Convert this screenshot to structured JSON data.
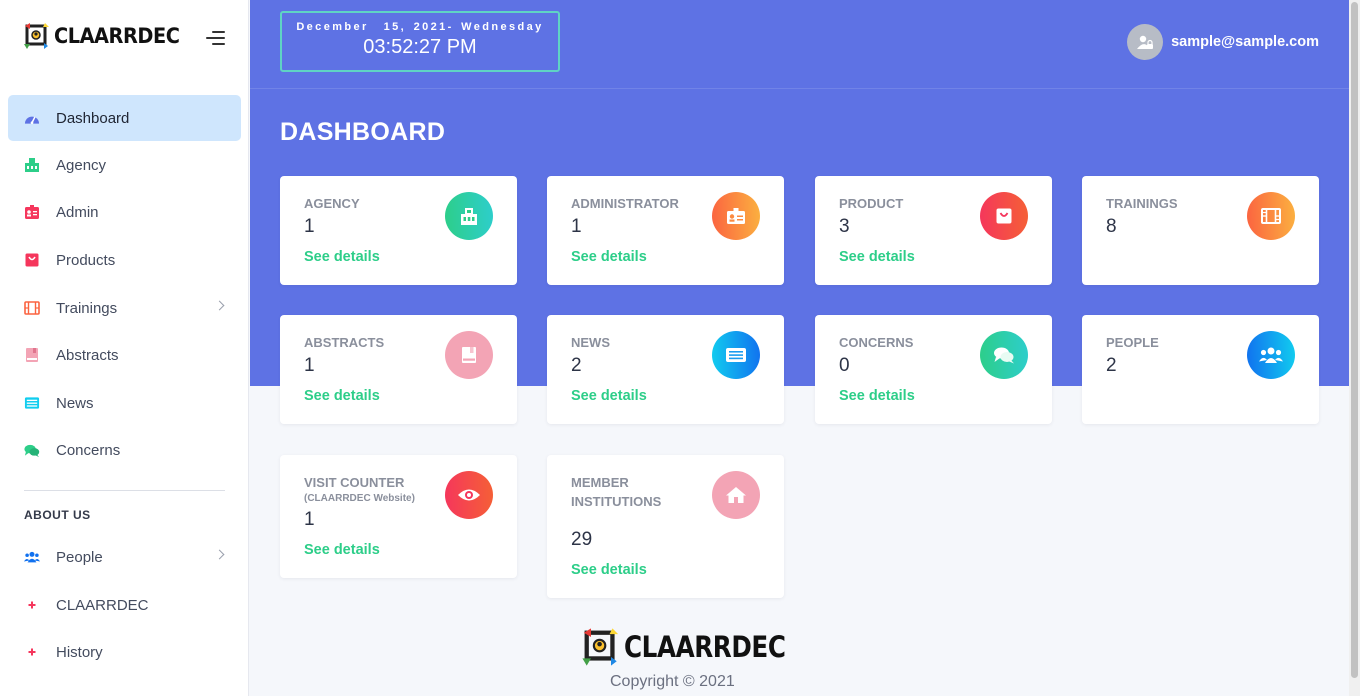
{
  "brand": {
    "name": "CLAARRDEC"
  },
  "header": {
    "date": "December  15, 2021- Wednesday",
    "time": "03:52:27 PM",
    "user_email": "sample@sample.com"
  },
  "sidebar": {
    "items": [
      {
        "label": "Dashboard",
        "icon": "dashboard-icon",
        "active": true
      },
      {
        "label": "Agency",
        "icon": "building-icon"
      },
      {
        "label": "Admin",
        "icon": "id-card-icon"
      },
      {
        "label": "Products",
        "icon": "shopping-bag-icon"
      },
      {
        "label": "Trainings",
        "icon": "film-icon",
        "has_submenu": true
      },
      {
        "label": "Abstracts",
        "icon": "book-icon"
      },
      {
        "label": "News",
        "icon": "newspaper-icon"
      },
      {
        "label": "Concerns",
        "icon": "comments-icon"
      }
    ],
    "section_label": "ABOUT US",
    "about_items": [
      {
        "label": "People",
        "icon": "users-icon",
        "has_submenu": true
      },
      {
        "label": "CLAARRDEC",
        "icon": "plus-icon"
      },
      {
        "label": "History",
        "icon": "plus-icon"
      }
    ]
  },
  "page": {
    "title": "DASHBOARD"
  },
  "cards": [
    {
      "title": "AGENCY",
      "value": "1",
      "link": "See details",
      "icon": "building-icon",
      "color": "#2dce89"
    },
    {
      "title": "ADMINISTRATOR",
      "value": "1",
      "link": "See details",
      "icon": "id-card-icon",
      "color": "#fb6340"
    },
    {
      "title": "PRODUCT",
      "value": "3",
      "link": "See details",
      "icon": "shopping-bag-icon",
      "color": "#f5365c"
    },
    {
      "title": "TRAININGS",
      "value": "8",
      "icon": "film-icon",
      "color": "#fb6340"
    },
    {
      "title": "ABSTRACTS",
      "value": "1",
      "link": "See details",
      "icon": "book-icon",
      "color": "#f3a4b5"
    },
    {
      "title": "NEWS",
      "value": "2",
      "link": "See details",
      "icon": "newspaper-icon",
      "color": "#11cdef"
    },
    {
      "title": "CONCERNS",
      "value": "0",
      "link": "See details",
      "icon": "comments-icon",
      "color": "#2dce89"
    },
    {
      "title": "PEOPLE",
      "value": "2",
      "icon": "users-icon",
      "color": "#1171ef"
    },
    {
      "title": "VISIT COUNTER",
      "subtitle": "(CLAARRDEC Website)",
      "value": "1",
      "link": "See details",
      "icon": "eye-icon",
      "color": "#f5365c"
    },
    {
      "title": "MEMBER INSTITUTIONS",
      "value": "29",
      "link": "See details",
      "icon": "home-icon",
      "color": "#f3a4b5"
    }
  ],
  "footer": {
    "logo_text": "CLAARRDEC",
    "copyright": "Copyright © 2021"
  }
}
